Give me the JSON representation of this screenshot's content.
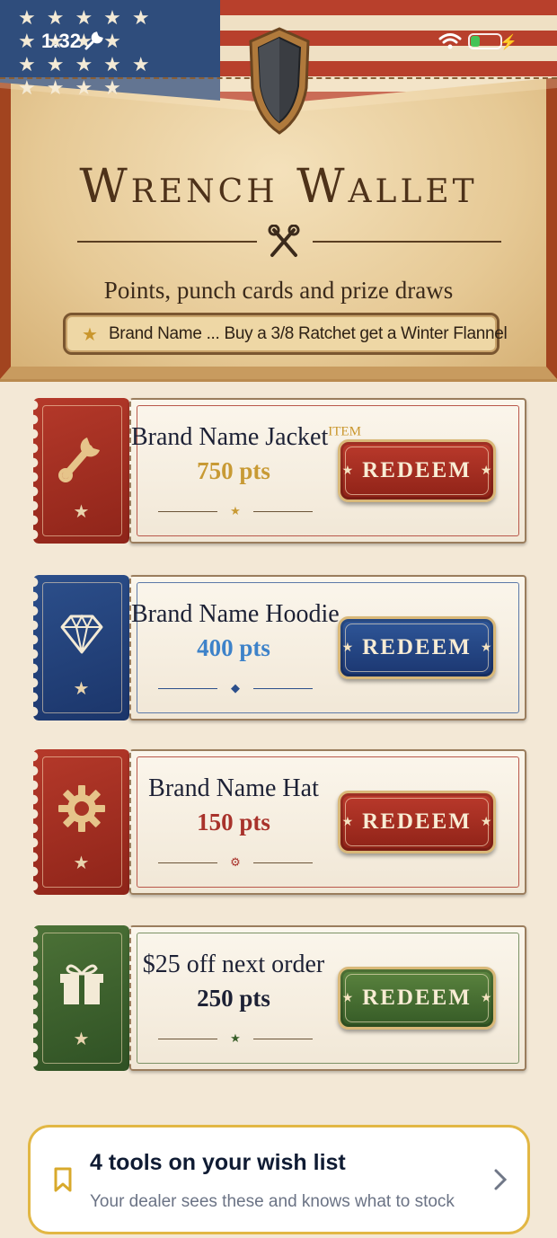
{
  "status_bar": {
    "time": "1:32"
  },
  "header": {
    "title": "Wrench Wallet",
    "subtitle": "Points, punch cards and prize draws",
    "banner": "Brand Name ... Buy a 3/8 Ratchet get a Winter Flannel"
  },
  "rewards": [
    {
      "title": "Brand Name Jacket",
      "tag": "ITEM",
      "points": "750 pts",
      "button": "REDEEM",
      "icon": "wrench-icon",
      "theme": "red",
      "pts_color": "#c89a34"
    },
    {
      "title": "Brand Name Hoodie",
      "points": "400 pts",
      "button": "REDEEM",
      "icon": "diamond-icon",
      "theme": "blue",
      "pts_color": "#3d82c9"
    },
    {
      "title": "Brand Name Hat",
      "points": "150 pts",
      "button": "REDEEM",
      "icon": "gear-icon",
      "theme": "red",
      "pts_color": "#a8322b"
    },
    {
      "title": "$25 off next order",
      "points": "250 pts",
      "button": "REDEEM",
      "icon": "gift-icon",
      "theme": "green",
      "pts_color": "#1d2135"
    }
  ],
  "wishlist": {
    "title": "4 tools on your wish list",
    "subtitle": "Your dealer sees these and knows what to stock"
  },
  "colors": {
    "accent_gold": "#e2b744",
    "red": "#a8322b",
    "blue": "#2c4f8b",
    "green": "#4c7237"
  }
}
